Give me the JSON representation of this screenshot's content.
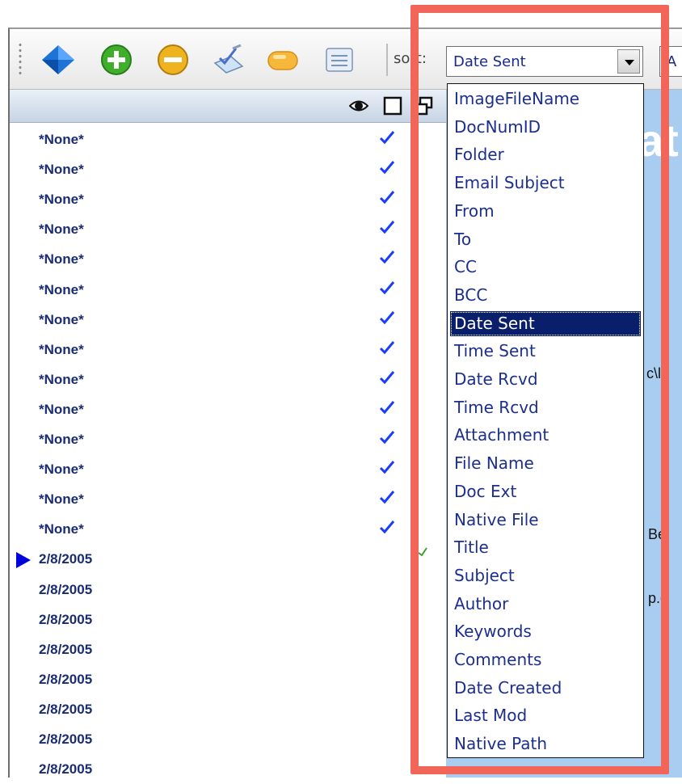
{
  "toolbar": {
    "icons": [
      "tag-diamond-icon",
      "add-icon",
      "remove-icon",
      "edit-check-icon",
      "label-tag-icon",
      "list-panel-icon"
    ],
    "sort_label": "sort:",
    "sort_value": "Date Sent",
    "order_value": "A"
  },
  "list_header": {
    "icons": [
      "eye-icon",
      "square-icon",
      "windows-icon"
    ]
  },
  "list": {
    "rows": [
      {
        "label": "*None*",
        "checked": true,
        "current": false
      },
      {
        "label": "*None*",
        "checked": true,
        "current": false
      },
      {
        "label": "*None*",
        "checked": true,
        "current": false
      },
      {
        "label": "*None*",
        "checked": true,
        "current": false
      },
      {
        "label": "*None*",
        "checked": true,
        "current": false
      },
      {
        "label": "*None*",
        "checked": true,
        "current": false
      },
      {
        "label": "*None*",
        "checked": true,
        "current": false
      },
      {
        "label": "*None*",
        "checked": true,
        "current": false
      },
      {
        "label": "*None*",
        "checked": true,
        "current": false
      },
      {
        "label": "*None*",
        "checked": true,
        "current": false
      },
      {
        "label": "*None*",
        "checked": true,
        "current": false
      },
      {
        "label": "*None*",
        "checked": true,
        "current": false
      },
      {
        "label": "*None*",
        "checked": true,
        "current": false
      },
      {
        "label": "*None*",
        "checked": true,
        "current": false
      },
      {
        "label": "2/8/2005",
        "checked": false,
        "current": true
      },
      {
        "label": "2/8/2005",
        "checked": false,
        "current": false
      },
      {
        "label": "2/8/2005",
        "checked": false,
        "current": false
      },
      {
        "label": "2/8/2005",
        "checked": false,
        "current": false
      },
      {
        "label": "2/8/2005",
        "checked": false,
        "current": false
      },
      {
        "label": "2/8/2005",
        "checked": false,
        "current": false
      },
      {
        "label": "2/8/2005",
        "checked": false,
        "current": false
      },
      {
        "label": "2/8/2005",
        "checked": false,
        "current": false
      }
    ]
  },
  "right_panel": {
    "heading": "at",
    "fragments": [
      "c\\l",
      "Be",
      "p.c"
    ]
  },
  "sort_dropdown": {
    "selected": "Date Sent",
    "options": [
      "ImageFileName",
      "DocNumID",
      "Folder",
      "Email Subject",
      "From",
      "To",
      "CC",
      "BCC",
      "Date Sent",
      "Time Sent",
      "Date Rcvd",
      "Time Rcvd",
      "Attachment",
      "File Name",
      "Doc Ext",
      "Native File",
      "Title",
      "Subject",
      "Author",
      "Keywords",
      "Comments",
      "Date Created",
      "Last Mod",
      "Native Path"
    ]
  },
  "colors": {
    "highlight": "#f2665a",
    "selected_option_bg": "#0a1f6b",
    "option_text": "#1c2f8f",
    "panel_blue": "#a9cdf0",
    "check_blue": "#1a3cff"
  }
}
